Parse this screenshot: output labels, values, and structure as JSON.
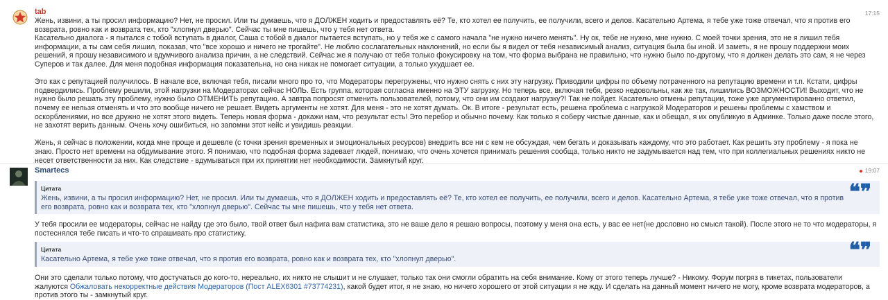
{
  "post1": {
    "author": "tab",
    "time": "17:15",
    "paragraphs": [
      "Жень, извини, а ты просил информацию? Нет, не просил. Или ты думаешь, что я ДОЛЖЕН ходить и предоставлять её? Те, кто хотел ее получить, ее получили, всего и делов. Касательно Артема, я тебе уже тоже отвечал, что я против его возврата, ровно как и возврата тех, кто \"хлопнул дверью\". Сейчас ты мне пишешь, что у тебя нет ответа.\nКасательно диалога - я пытался с тобой вступать в диалог, Саша с тобой в диалог пытается вступать, но у тебя же с самого начала \"не нужно ничего менять\". Ну ок, тебе не нужно, мне нужно. С моей точки зрения, это не я лишил тебя информации, а ты сам себя лишил, показав, что \"все хорошо и ничего не трогайте\". Не люблю сослагательных наклонений, но если бы я видел от тебя независимый анализ, ситуация была бы иной. И заметь, я не прошу поддержки моих решений, я прошу независимого и вдумчивого анализа причин, а не следствий. Сейчас же я получаю от тебя только фокусировку на том, что форма выбрана не правильно, что нужно было по-другому, что я должен делать это сам, я не через Суперов и так далее. Для меня подобная информация показательна, но она никак не помогает ситуации, а только ухудшает ее.",
      "Это как с репутацией получилось. В начале все, включая тебя, писали много про то, что Модераторы перегружены, что нужно снять с них эту нагрузку. Приводили цифры по объему потраченного на репутацию времени и т.п. Кстати, цифры подвердились. Проблему решили, этой нагрузки на Модераторах сейчас НОЛЬ. Есть группа, которая согласна именно на ЭТУ загрузку. Но теперь все, включая тебя, резко недовольны, как же так, лишились ВОЗМОЖНОСТИ! Выходит, что не нужно было решать эту проблему, нужно было ОТМЕНИТЬ репутацию. А завтра попросят отменить пользователей, потому, что они им создают нагрузку?! Так не пойдет. Касательно отмены репутации, тоже уже аргументированно ответил, почему ее нельзя отменять и что это вообще ничего не решает. Видеть аргументы не хотят. Для меня - это не хотят думать. Ок. В итоге - результат есть, решена проблема с нагрузкой Модераторов и решены проблемы с хамством и оскорблениями, но все дружно не хотят этого видеть. Теперь новая форма - докажи нам, что результат есть! Это перебор и обычно почему. Как только я соберу чистые данные, как и обещал, я их опубликую в Админке. Только даже после этого, не захотят верить данным. Очень хочу ошибиться, но запомни этот кейс и увидишь реакции.",
      "Жень, я сейчас в положении, когда мне проще и дешевле (с точки зрения временных и эмоциональных ресурсов) внедрить все ни с кем не обсуждая, чем бегать и доказывать каждому, что это работает. Как решить эту проблему - я пока не знаю. Просто нет времени на обдумывание этого. Я понимаю, что подобная форма задевает людей, понимаю, что очень хочется принимать решения сообща, только никто не задумывается над тем, что при коллегиальных решениях никто не несет ответственности за них. Как следствие - вдумываться при их принятии нет необходимости. Замкнутый круг."
    ]
  },
  "post2": {
    "author": "Smartecs",
    "time": "19:07",
    "quote_label": "Цитата",
    "quote1_text": "Жень, извини, а ты просил информацию? Нет, не просил. Или ты думаешь, что я ДОЛЖЕН ходить и предоставлять её? Те, кто хотел ее получить, ее получили, всего и делов. Касательно Артема, я тебе уже тоже отвечал, что я против его возврата, ровно как и возврата тех, кто \"хлопнул дверью\". Сейчас ты мне пишешь, что у тебя нет ответа.",
    "reply1": "У тебя просили ее модераторы, сейчас не найду где это было, твой ответ был нафига вам статистика, это не ваше дело я решаю вопросы, поэтому у меня она есть, у вас ее нет(не дословно но смысл такой). После этого не то что модераторы, я постеснялся тебе писать и что-то спрашивать про статистику.",
    "quote2_text": "Касательно Артема, я тебе уже тоже отвечал, что я против его возврата, ровно как и возврата тех, кто \"хлопнул дверью\".",
    "reply2_before": "Они это сделали только потому, что достучаться до кого-то, нереально, их никто не слышит и не слушает, только так они смогли обратить на себя внимание. Кому от этого теперь лучше? - Никому. Форум погряз в тикетах, пользователи жалуются ",
    "reply2_link": "Обжаловать некорректные действия Модераторов (Пост ALEX6301 #73774231)",
    "reply2_after": ", какой будет итог, я не знаю, но ничего хорошего от этой ситуации я не жду. И сделать на данный момент ничего не могу, кроме возврата модераторов, а против этого ты - замкнутый круг."
  },
  "icons": {
    "post1_avatar": "star-emblem-icon",
    "post2_avatar": "user-photo-icon",
    "quote_mark": "quote-marks-icon",
    "online": "online-indicator-icon"
  },
  "colors": {
    "author_tab": "#c63a2c",
    "author_smartecs": "#2d4b7a",
    "quote_bg": "#eef2f8",
    "quote_text": "#3a4d7a",
    "quote_mark": "#1f5fa8",
    "link": "#2d62a8",
    "online": "#e0342f"
  }
}
